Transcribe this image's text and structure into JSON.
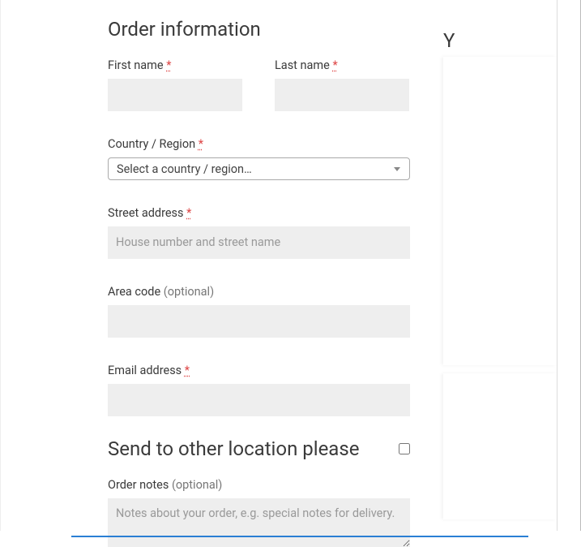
{
  "heading_order": "Order information",
  "labels": {
    "first_name": "First name",
    "last_name": "Last name",
    "country": "Country / Region",
    "street": "Street address",
    "area_code": "Area code",
    "email": "Email address",
    "order_notes": "Order notes"
  },
  "optional_suffix": "(optional)",
  "required_marker": "*",
  "placeholders": {
    "country_select": "Select a country / region…",
    "street": "House number and street name",
    "order_notes": "Notes about your order, e.g. special notes for delivery."
  },
  "values": {
    "first_name": "",
    "last_name": "",
    "country": "",
    "street": "",
    "area_code": "",
    "email": "",
    "order_notes": "",
    "ship_other_checked": false
  },
  "ship_heading": "Send to other location please",
  "right_heading": "Y"
}
